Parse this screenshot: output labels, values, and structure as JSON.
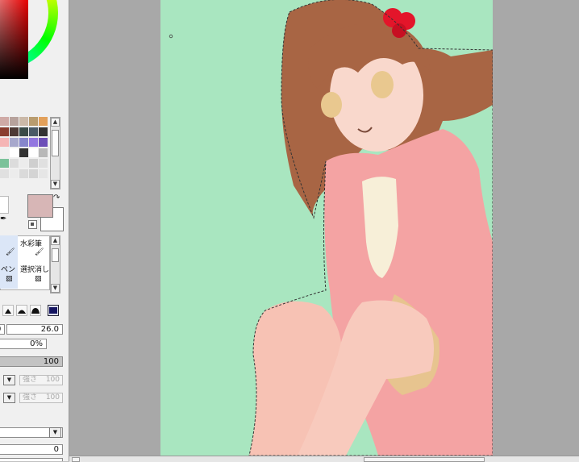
{
  "color_panel": {
    "main_color": "#d7b6b6",
    "sub_color": "#ffffff"
  },
  "swatches": [
    "#e9a1a1",
    "#cfaaa6",
    "#b7a29c",
    "#cbb9a8",
    "#b99c6e",
    "#e2a05a",
    "#a50f1a",
    "#8a3d2f",
    "#4e3a35",
    "#3a4b48",
    "#4a5a66",
    "#333333",
    "#eb8c8c",
    "#f5b5b5",
    "#a7a8cc",
    "#8686cc",
    "#9276e0",
    "#6d4fb8",
    "#f3e6c9",
    "#f0f0f0",
    "#ffffff",
    "#333333",
    "#ffffff",
    "#b8b8b8",
    "#4ad06e",
    "#7bc29a",
    "#dcdcdc",
    "#ececec",
    "#cfcfcf",
    "#e0e0e0",
    "#2c9c4a",
    "#e0e0e0",
    "#ececec",
    "#dadada",
    "#d4d4d4",
    "#e6e6e6"
  ],
  "tools": {
    "watercolor": "水彩筆",
    "pen": "ペン",
    "eraser": "選択消し"
  },
  "brush": {
    "size_multiplier": "0",
    "size": "26.0",
    "min_size": "0%",
    "density": "100",
    "strength_1": {
      "label": "強さ",
      "value": "100"
    },
    "strength_2": {
      "label": "強さ",
      "value": "100"
    },
    "bottom_value": "0"
  },
  "icons": {
    "swap": "swap-colors-icon",
    "reset": "reset-colors-icon",
    "dropper": "eyedropper-icon"
  }
}
